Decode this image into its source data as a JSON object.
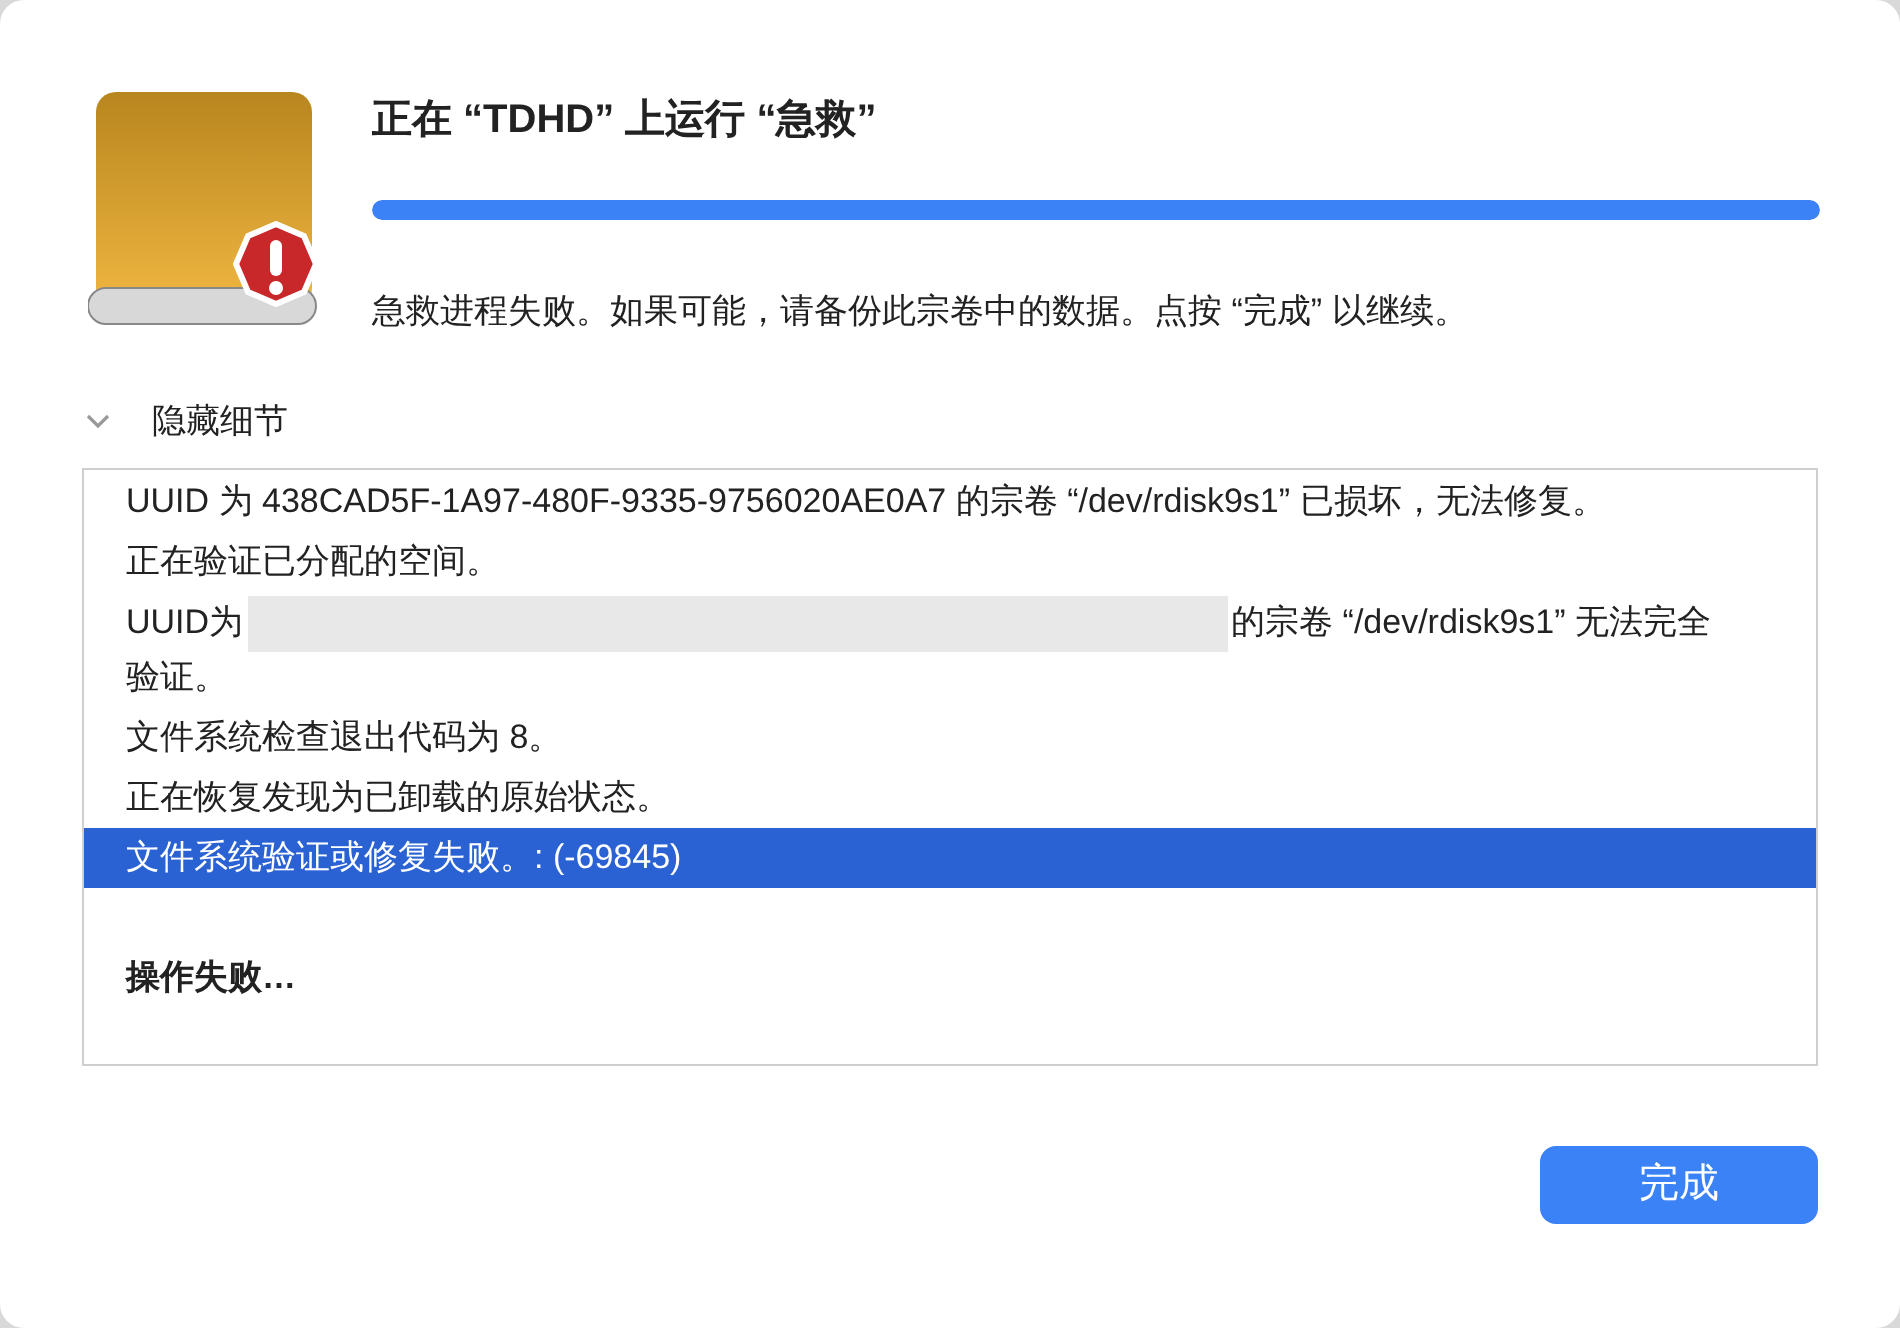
{
  "dialog": {
    "title": "正在 “TDHD” 上运行 “急救”",
    "progress": {
      "level": 1
    },
    "message": "急救进程失败。如果可能，请备份此宗卷中的数据。点按 “完成” 以继续。",
    "details_toggle": {
      "label": "隐藏细节",
      "expanded": true
    },
    "log": [
      {
        "kind": "text",
        "text": "UUID 为 438CAD5F-1A97-480F-9335-9756020AE0A7 的宗卷 “/dev/rdisk9s1” 已损坏，无法修复。",
        "selected": false
      },
      {
        "kind": "text",
        "text": "正在验证已分配的空间。",
        "selected": false
      },
      {
        "kind": "redacted",
        "before": "UUID为",
        "after": "的宗卷 “/dev/rdisk9s1” 无法完全验证。",
        "selected": false
      },
      {
        "kind": "text",
        "text": "文件系统检查退出代码为 8。",
        "selected": false
      },
      {
        "kind": "text",
        "text": "正在恢复发现为已卸载的原始状态。",
        "selected": false
      },
      {
        "kind": "text",
        "text": "文件系统验证或修复失败。: (-69845)",
        "selected": true
      },
      {
        "kind": "heading",
        "text": "操作失败…",
        "selected": false
      }
    ],
    "buttons": [
      {
        "label": "完成",
        "default": true
      }
    ]
  }
}
